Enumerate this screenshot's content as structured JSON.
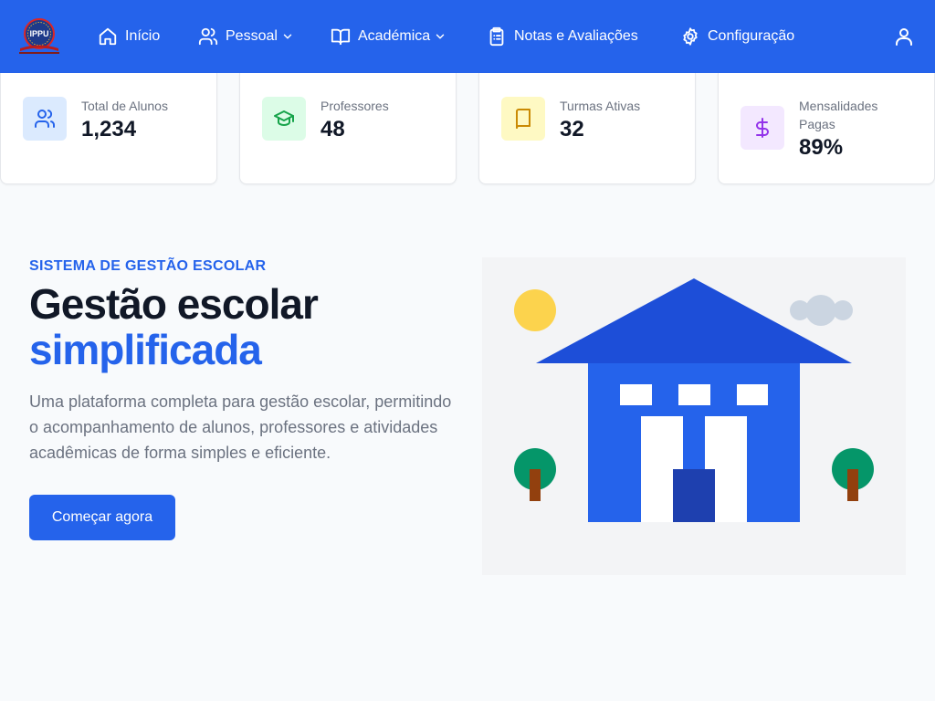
{
  "brand": {
    "logo_text": "IPPU"
  },
  "nav": {
    "items": [
      {
        "label": "Início",
        "icon": "home-icon"
      },
      {
        "label": "Pessoal",
        "icon": "users-icon",
        "dropdown": true
      },
      {
        "label": "Académica",
        "icon": "book-open-icon",
        "dropdown": true
      },
      {
        "label": "Notas e Avaliações",
        "icon": "clipboard-list-icon"
      },
      {
        "label": "Configuração",
        "icon": "gear-icon"
      }
    ],
    "user_icon": "user-icon"
  },
  "stats": [
    {
      "label": "Total de Alunos",
      "value": "1,234",
      "icon": "users-icon",
      "color": "#2563eb",
      "bg": "#dbeafe"
    },
    {
      "label": "Professores",
      "value": "48",
      "icon": "graduation-cap-icon",
      "color": "#16a34a",
      "bg": "#dcfce7"
    },
    {
      "label": "Turmas Ativas",
      "value": "32",
      "icon": "book-icon",
      "color": "#ca8a04",
      "bg": "#fef9c3"
    },
    {
      "label": "Mensalidades Pagas",
      "value": "89%",
      "icon": "dollar-icon",
      "color": "#9333ea",
      "bg": "#f3e8ff"
    }
  ],
  "hero": {
    "eyebrow": "SISTEMA DE GESTÃO ESCOLAR",
    "title_line1": "Gestão escolar",
    "title_line2": "simplificada",
    "description": "Uma plataforma completa para gestão escolar, permitindo o acompanhamento de alunos, professores e atividades acadêmicas de forma simples e eficiente.",
    "cta_label": "Começar agora"
  },
  "colors": {
    "primary": "#2563eb",
    "roof": "#1d4ed8",
    "door": "#1e40af",
    "sun": "#fcd34d",
    "cloud": "#cbd5e1",
    "tree": "#059669",
    "trunk": "#92400e"
  }
}
